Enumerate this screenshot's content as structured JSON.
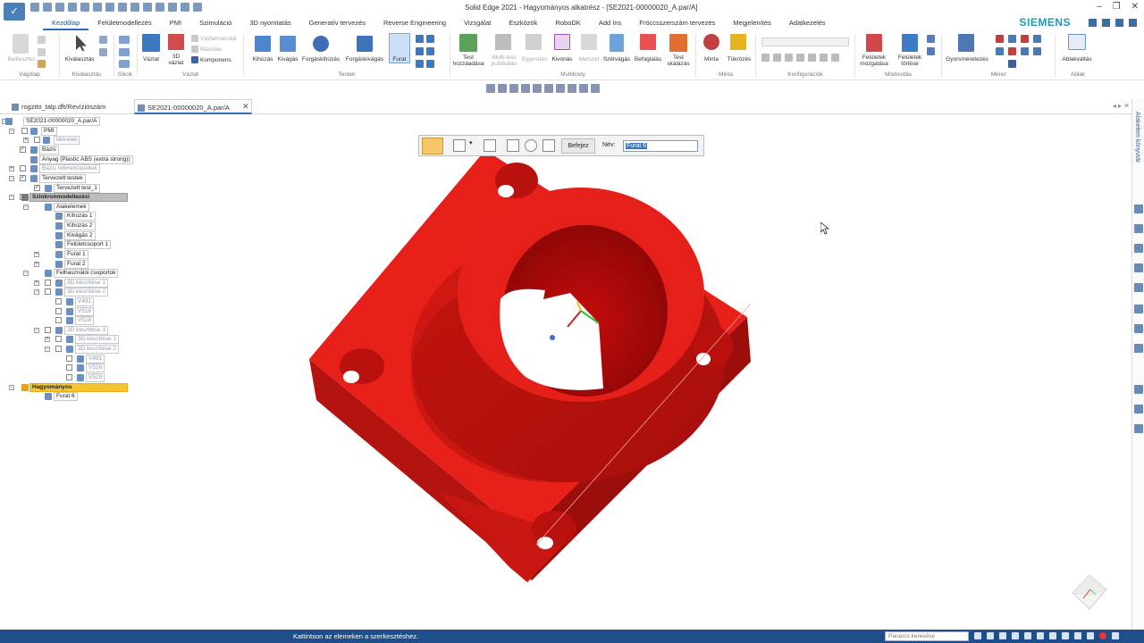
{
  "window": {
    "title": "Solid Edge 2021 - Hagyományos alkatrész - [SE2021-00000020_A.par/A]",
    "logo_glyph": "✓"
  },
  "brand": "SIEMENS",
  "tabs": [
    {
      "label": "Kezdőlap",
      "active": true
    },
    {
      "label": "Felületmodellezés"
    },
    {
      "label": "PMI"
    },
    {
      "label": "Szimuláció"
    },
    {
      "label": "3D nyomtatás"
    },
    {
      "label": "Generatív tervezés"
    },
    {
      "label": "Reverse Engineering"
    },
    {
      "label": "Vizsgálat"
    },
    {
      "label": "Eszközök"
    },
    {
      "label": "RoboDK"
    },
    {
      "label": "Add Ins"
    },
    {
      "label": "Fröccsszerszám tervezés"
    },
    {
      "label": "Megjelenítés"
    },
    {
      "label": "Adatkezelés"
    }
  ],
  "ribbon": {
    "groups": {
      "vagolap": "Vágólap",
      "kivalasztas": "Kiválasztás",
      "sikok": "Síkok",
      "vazlat": "Vázlat",
      "testek": "Testek",
      "multibody": "Multibody",
      "minta": "Minta",
      "konfiguraciok": "Konfigurációk",
      "modositas": "Módosítás",
      "meret": "Méret",
      "ablak": "Ablak"
    },
    "buttons": {
      "beillesztes": "Beillesztés",
      "kivalasztas": "Kiválasztás",
      "vazlat": "Vázlat",
      "vazlat3d_a": "3D",
      "vazlat3d_b": "vázlat",
      "vazlatmasolat": "Vázlatmásolat",
      "masolas": "Másolás",
      "komponens": "Komponens",
      "kihuzas": "Kihúzás",
      "kivagas": "Kivágás",
      "forgaskihuzas": "Forgáskihúzás",
      "forgaskivagas": "Forgáskivágás",
      "furat": "Furat",
      "test_hozzaadasa_a": "Test",
      "test_hozzaadasa_b": "hozzáadása",
      "multitest_a": "Multi-test",
      "multitest_b": "publikálás",
      "egyesites": "Egyesítés",
      "kivonas": "Kivonás",
      "metszet": "Metszet",
      "szetvagas": "Szétvágás",
      "befoglalas": "Befoglalás",
      "test_skalazas_a": "Test",
      "test_skalazas_b": "skálázás",
      "minta": "Minta",
      "tukrozes": "Tükrözés",
      "feluletek_mozgatasa_a": "Felületek",
      "feluletek_mozgatasa_b": "mozgatása",
      "feluletek_torlese_a": "Felületek",
      "feluletek_torlese_b": "törlése",
      "gyorsmeretezes": "Gyorsméretezés",
      "ablakvaltas": "Ablakváltás"
    }
  },
  "doc_tabs": [
    {
      "label": "rogzito_talp.dft/Revíziószám",
      "active": false
    },
    {
      "label": "SE2021-00000020_A.par/A",
      "active": true
    }
  ],
  "doc_tab_close": "✕",
  "tree": {
    "root": "SE2021-00000020_A.par/A",
    "pmi": "PMI",
    "meretek": "Méretek",
    "bazis": "Bázis",
    "anyag": "Anyag (Plastic ABS (extra strong))",
    "bazis_ref": "Bázis referenciasíkok",
    "tervezett_testek": "Tervezett testek",
    "tervezett_test_1": "Tervezett test_1",
    "szinkron": "Szinkronmodellezési",
    "alakelemek": "Alakelemek",
    "kihuzas1": "Kihúzás 1",
    "kihuzas2": "Kihúzás 2",
    "kivagas2": "Kivágás 2",
    "feluletcsoport1": "Felületcsoport 1",
    "furat1": "Furat 1",
    "furat2": "Furat 2",
    "felhasznaloi": "Felhasználói csoportok",
    "keszites1": "3D készítése 1",
    "keszites2": "3D készítése 2",
    "v491_a": "V491",
    "v516_a": "V516",
    "v528_a": "V528",
    "keszites3": "3D készítése 3",
    "keszites3_1": "3D készítése 1",
    "keszites3_2": "3D készítése 2",
    "v491_b": "V491",
    "v516_b": "V516",
    "v528_b": "V528",
    "hagyomanyos": "Hagyományos",
    "furat6": "Furat 6"
  },
  "command_bar": {
    "finish_label": "Befejez",
    "name_label": "Név:",
    "name_value": "Furat 6"
  },
  "right_pane_label": "Alakelem könyvtár",
  "statusbar": {
    "message": "Kattintson az elemeken a szerkesztéshez.",
    "search_placeholder": "Parancs keresése"
  },
  "colors": {
    "model_red": "#e8201a",
    "status_blue": "#1e4f88",
    "brand_teal": "#1d9ab2",
    "active_tab": "#2f6db5"
  }
}
